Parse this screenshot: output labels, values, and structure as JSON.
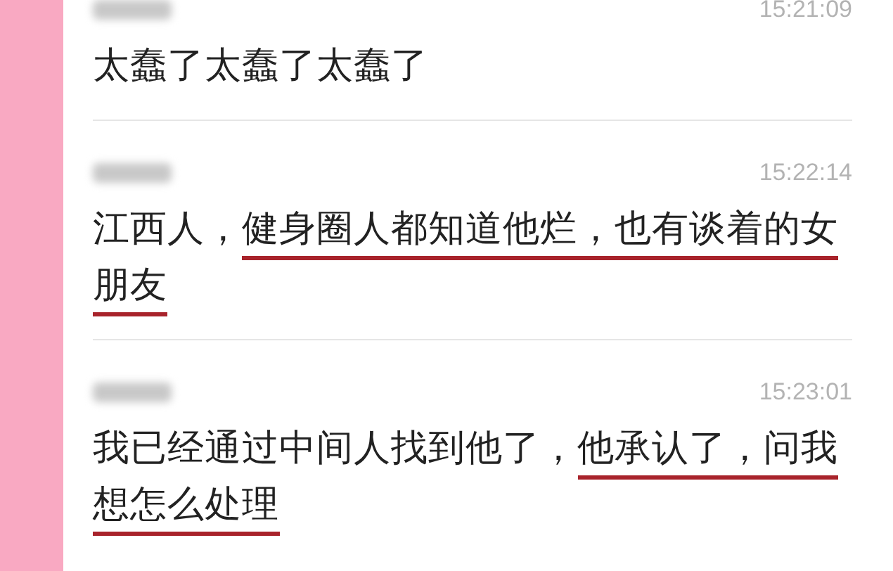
{
  "messages": [
    {
      "time": "15:21:09",
      "segments": [
        {
          "text": "太蠢了太蠢了太蠢了",
          "underlined": false
        }
      ]
    },
    {
      "time": "15:22:14",
      "segments": [
        {
          "text": "江西人，",
          "underlined": false
        },
        {
          "text": "健身圈人都知道他烂，",
          "underlined": true
        },
        {
          "text": "也有谈着的女朋友",
          "underlined": true
        }
      ]
    },
    {
      "time": "15:23:01",
      "segments": [
        {
          "text": "我已经通过中间人找到他了，",
          "underlined": false
        },
        {
          "text": "他承认了，问我想怎么处理",
          "underlined": true
        }
      ]
    }
  ]
}
